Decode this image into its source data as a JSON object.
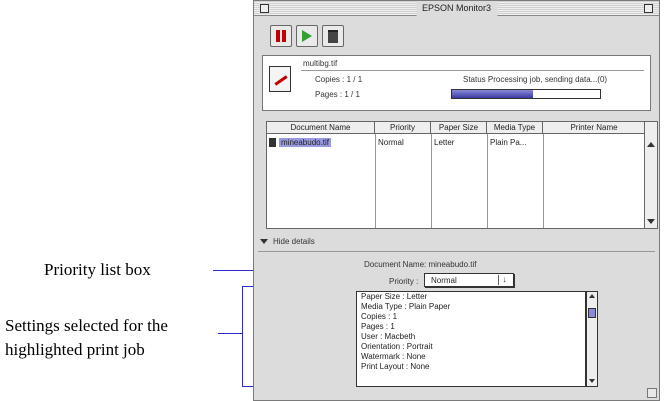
{
  "window": {
    "title": "EPSON Monitor3"
  },
  "toolbar": {
    "pause_icon": "pause-icon",
    "resume_icon": "play-icon",
    "delete_icon": "trash-icon"
  },
  "job": {
    "filename": "multibg.tif",
    "copies": "Copies : 1 / 1",
    "pages": "Pages : 1 / 1",
    "status": "Status Processing job, sending data...(0)",
    "progress": 0.55
  },
  "table": {
    "columns": [
      "Document Name",
      "Priority",
      "Paper Size",
      "Media Type",
      "Printer Name"
    ],
    "rows": [
      {
        "doc": "mineabudo.tif",
        "priority": "Normal",
        "paper": "Letter",
        "media": "Plain Pa..."
      }
    ]
  },
  "details": {
    "hide_label": "Hide details",
    "doc_name": "Document Name: mineabudo.tif",
    "priority_label": "Priority :",
    "priority_value": "Normal",
    "settings": [
      "Paper Size : Letter",
      "Media Type : Plain Paper",
      "Copies : 1",
      "Pages : 1",
      "User : Macbeth",
      "Orientation : Portrait",
      "Watermark : None",
      "Print Layout : None"
    ]
  },
  "callouts": {
    "priority": "Priority list box",
    "settings": "Settings selected for the highlighted print job"
  }
}
